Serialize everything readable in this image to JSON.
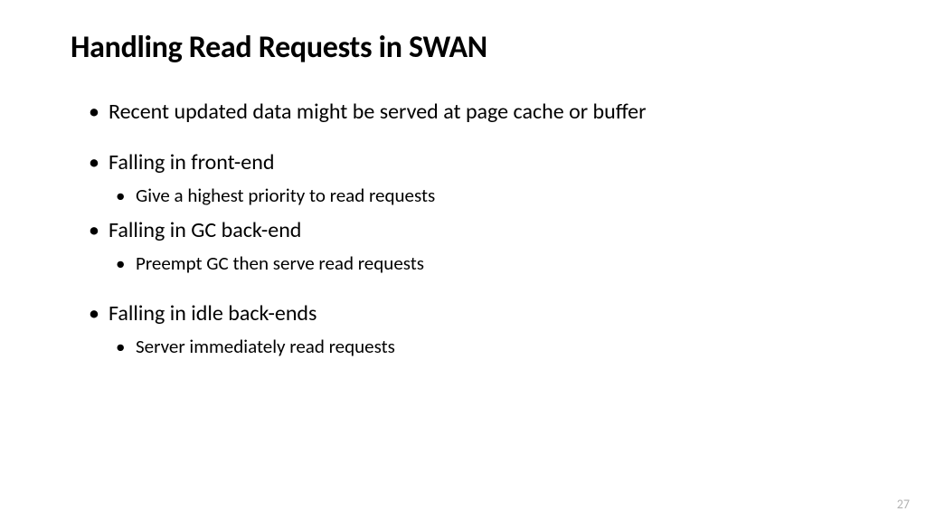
{
  "title": "Handling Read Requests in SWAN",
  "bullets": {
    "b1": "Recent updated data might be served at page cache or buffer",
    "b2": "Falling in front-end",
    "b2_1": "Give a highest priority to read requests",
    "b3": "Falling in GC back-end",
    "b3_1": "Preempt GC then serve read requests",
    "b4": "Falling in idle back-ends",
    "b4_1": "Server immediately read requests"
  },
  "page_number": "27"
}
